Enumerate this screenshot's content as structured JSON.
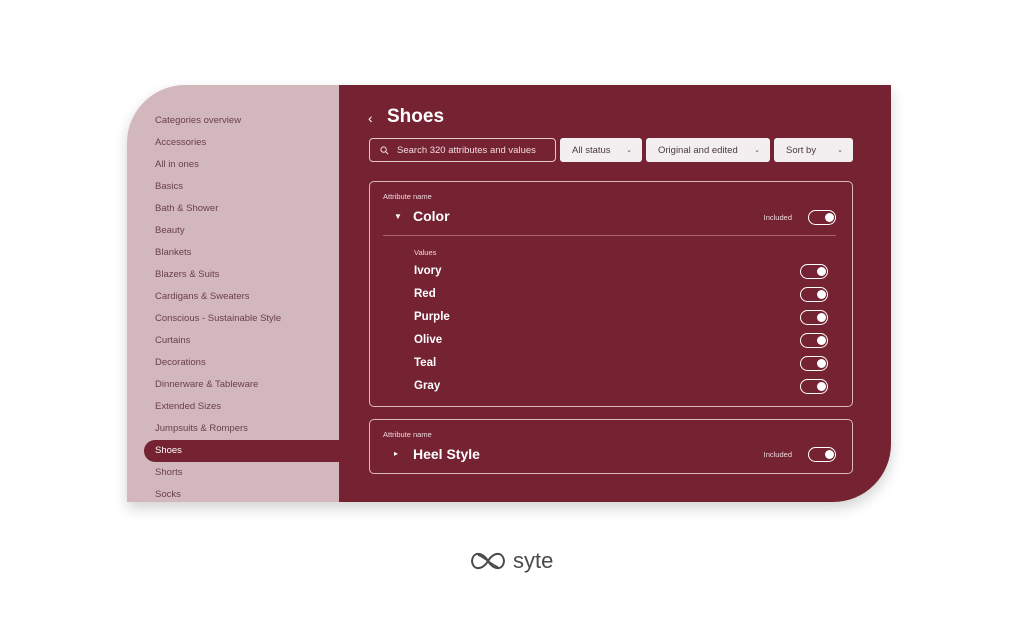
{
  "sidebar": {
    "items": [
      {
        "label": "Categories overview"
      },
      {
        "label": "Accessories"
      },
      {
        "label": "All in ones"
      },
      {
        "label": "Basics"
      },
      {
        "label": "Bath & Shower"
      },
      {
        "label": "Beauty"
      },
      {
        "label": "Blankets"
      },
      {
        "label": "Blazers & Suits"
      },
      {
        "label": "Cardigans & Sweaters"
      },
      {
        "label": "Conscious - Sustainable Style"
      },
      {
        "label": "Curtains"
      },
      {
        "label": "Decorations"
      },
      {
        "label": "Dinnerware & Tableware"
      },
      {
        "label": "Extended Sizes"
      },
      {
        "label": "Jumpsuits & Rompers"
      },
      {
        "label": "Shoes",
        "active": true
      },
      {
        "label": "Shorts"
      },
      {
        "label": "Socks"
      }
    ]
  },
  "header": {
    "back_icon": "chevron-left-icon",
    "title": "Shoes"
  },
  "toolbar": {
    "search_placeholder": "Search 320 attributes and values",
    "status_filter": "All status",
    "edit_filter": "Original and edited",
    "sort": "Sort by"
  },
  "attributes": [
    {
      "label": "Attribute name",
      "name": "Color",
      "expanded": true,
      "included_label": "Included",
      "included": true,
      "values_label": "Values",
      "values": [
        {
          "name": "Ivory",
          "on": true
        },
        {
          "name": "Red",
          "on": true
        },
        {
          "name": "Purple",
          "on": true
        },
        {
          "name": "Olive",
          "on": true
        },
        {
          "name": "Teal",
          "on": true
        },
        {
          "name": "Gray",
          "on": true
        }
      ]
    },
    {
      "label": "Attribute name",
      "name": "Heel Style",
      "expanded": false,
      "included_label": "Included",
      "included": true
    }
  ],
  "brand": {
    "name": "syte"
  },
  "colors": {
    "primary": "#752232",
    "sidebar_bg": "#d2b7bd",
    "sidebar_text": "#6a3f48"
  }
}
